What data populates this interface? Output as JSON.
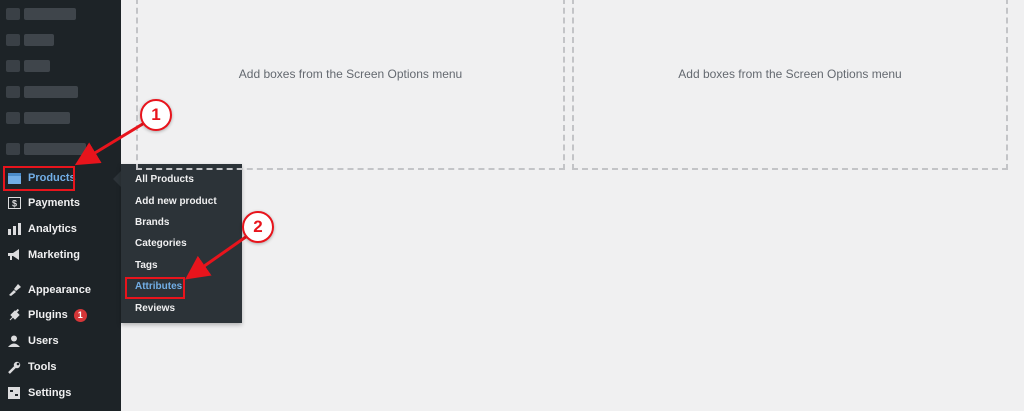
{
  "sidebar": {
    "items": [
      {
        "label": "Products",
        "icon": "products-icon",
        "active": true
      },
      {
        "label": "Payments",
        "icon": "payments-icon"
      },
      {
        "label": "Analytics",
        "icon": "analytics-icon"
      },
      {
        "label": "Marketing",
        "icon": "marketing-icon"
      },
      {
        "label": "Appearance",
        "icon": "appearance-icon"
      },
      {
        "label": "Plugins",
        "icon": "plugins-icon",
        "badge": "1"
      },
      {
        "label": "Users",
        "icon": "users-icon"
      },
      {
        "label": "Tools",
        "icon": "tools-icon"
      },
      {
        "label": "Settings",
        "icon": "settings-icon"
      }
    ]
  },
  "submenu": {
    "items": [
      "All Products",
      "Add new product",
      "Brands",
      "Categories",
      "Tags",
      "Attributes",
      "Reviews"
    ],
    "highlighted": "Attributes"
  },
  "main": {
    "placeholder_left": "Add boxes from the Screen Options menu",
    "placeholder_right": "Add boxes from the Screen Options menu"
  },
  "annotations": {
    "step1": "1",
    "step2": "2",
    "color": "#e8141c"
  },
  "colors": {
    "sidebar_bg": "#1d2327",
    "flyout_bg": "#2c3338",
    "active_text": "#72aee6",
    "page_bg": "#f0f0f1"
  }
}
